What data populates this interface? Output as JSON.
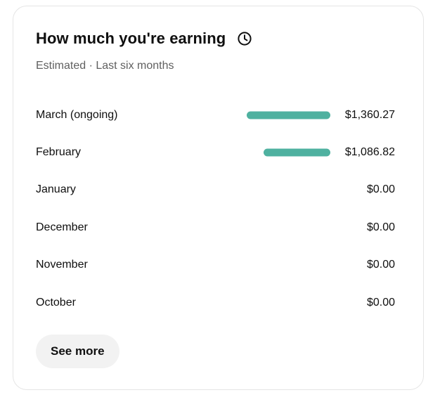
{
  "card": {
    "title": "How much you're earning",
    "subtitle": "Estimated · Last six months",
    "history_icon": "clock-icon"
  },
  "accent_color": "#4fb1a0",
  "earnings": [
    {
      "month": "March (ongoing)",
      "value": "$1,360.27",
      "amount": 1360.27
    },
    {
      "month": "February",
      "value": "$1,086.82",
      "amount": 1086.82
    },
    {
      "month": "January",
      "value": "$0.00",
      "amount": 0
    },
    {
      "month": "December",
      "value": "$0.00",
      "amount": 0
    },
    {
      "month": "November",
      "value": "$0.00",
      "amount": 0
    },
    {
      "month": "October",
      "value": "$0.00",
      "amount": 0
    }
  ],
  "see_more_label": "See more"
}
